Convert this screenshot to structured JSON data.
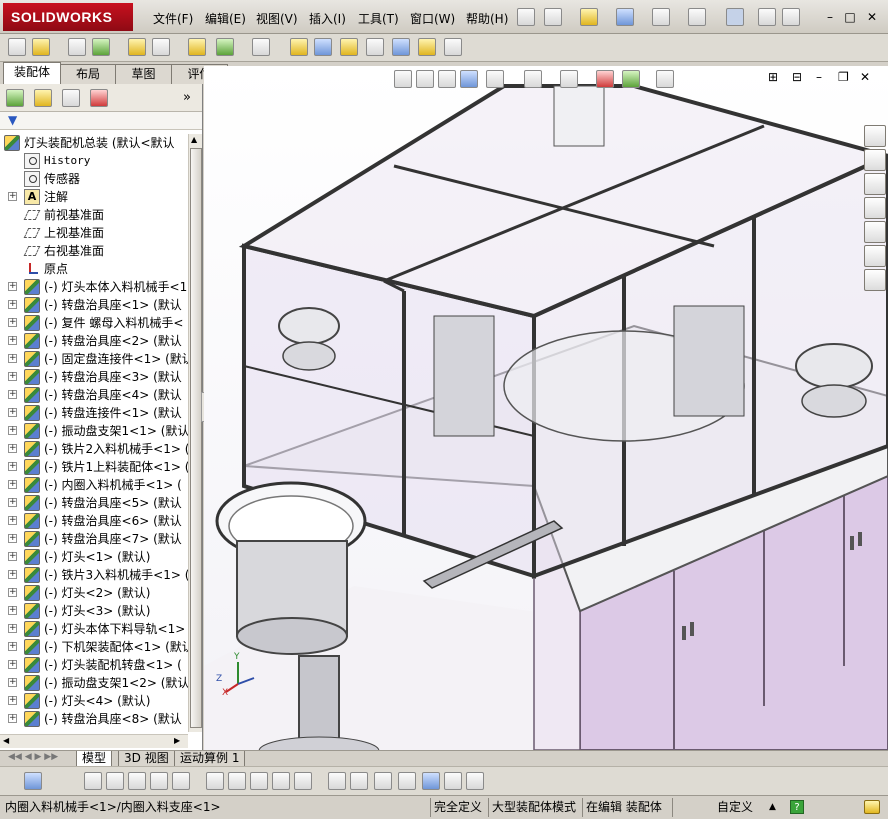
{
  "app": {
    "logo_text": "SOLIDWORKS",
    "brand_color": "#c8101e"
  },
  "menu": [
    "文件(F)",
    "编辑(E)",
    "视图(V)",
    "插入(I)",
    "工具(T)",
    "窗口(W)",
    "帮助(H)"
  ],
  "tabs": [
    "装配体",
    "布局",
    "草图",
    "评估"
  ],
  "tree": {
    "root": "灯头装配机总装  (默认<默认",
    "history": "History",
    "sensors": "传感器",
    "annotations": "注解",
    "planes": [
      "前视基准面",
      "上视基准面",
      "右视基准面"
    ],
    "origin": "原点",
    "components": [
      "(-) 灯头本体入料机械手<1",
      "(-) 转盘治具座<1> (默认",
      "(-) 复件 螺母入料机械手<",
      "(-) 转盘治具座<2> (默认",
      "(-) 固定盘连接件<1> (默认",
      "(-) 转盘治具座<3> (默认",
      "(-) 转盘治具座<4> (默认",
      "(-) 转盘连接件<1> (默认",
      "(-) 振动盘支架1<1> (默认",
      "(-) 铁片2入料机械手<1> (",
      "(-) 铁片1上料装配体<1> (",
      "(-) 内圈入料机械手<1> (",
      "(-) 转盘治具座<5> (默认",
      "(-) 转盘治具座<6> (默认",
      "(-) 转盘治具座<7> (默认",
      "(-) 灯头<1> (默认)",
      "(-) 铁片3入料机械手<1> (",
      "(-) 灯头<2> (默认)",
      "(-) 灯头<3> (默认)",
      "(-) 灯头本体下料导轨<1>",
      "(-) 下机架装配体<1> (默认",
      "(-) 灯头装配机转盘<1> (",
      "(-) 振动盘支架1<2> (默认",
      "(-) 灯头<4> (默认)",
      "(-) 转盘治具座<8> (默认"
    ]
  },
  "bottom_tabs": [
    "模型",
    "3D 视图",
    "运动算例 1"
  ],
  "status": {
    "path": "内圈入料机械手<1>/内圈入料支座<1>",
    "defined": "完全定义",
    "large_mode": "大型装配体模式",
    "editing": "在编辑 装配体",
    "custom": "自定义",
    "custom_arrow": "▲"
  },
  "triad": {
    "x": "X",
    "y": "Y",
    "z": "Z"
  },
  "colors": {
    "frame": "#7d7d80",
    "glass": "#e6dff0",
    "cabinet": "#dcc9e6",
    "cabinet_edge": "#6a5a70"
  }
}
